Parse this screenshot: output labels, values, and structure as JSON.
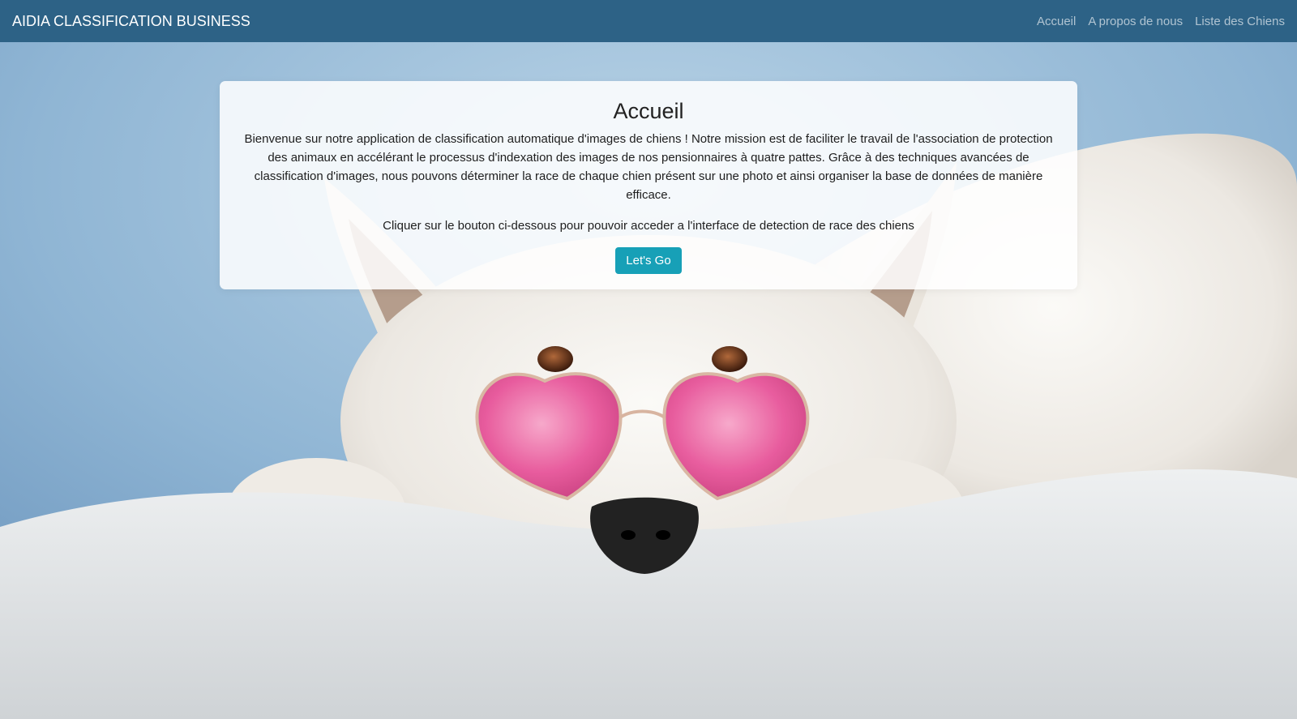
{
  "navbar": {
    "brand": "AIDIA CLASSIFICATION BUSINESS",
    "links": [
      "Accueil",
      "A propos de nous",
      "Liste des Chiens"
    ]
  },
  "home": {
    "title": "Accueil",
    "intro": "Bienvenue sur notre application de classification automatique d'images de chiens ! Notre mission est de faciliter le travail de l'association de protection des animaux en accélérant le processus d'indexation des images de nos pensionnaires à quatre pattes. Grâce à des techniques avancées de classification d'images, nous pouvons déterminer la race de chaque chien présent sur une photo et ainsi organiser la base de données de manière efficace.",
    "instruction": "Cliquer sur le bouton ci-dessous pour pouvoir acceder a l'interface de detection de race des chiens",
    "button_label": "Let's Go"
  },
  "colors": {
    "navbar_bg": "#2d6286",
    "button_bg": "#17a0b7",
    "sky_blue": "#9fc1dd",
    "glasses_pink": "#e8559a"
  },
  "background_image": {
    "subject": "white dog wearing pink heart-shaped sunglasses lying on a white fluffy blanket"
  }
}
